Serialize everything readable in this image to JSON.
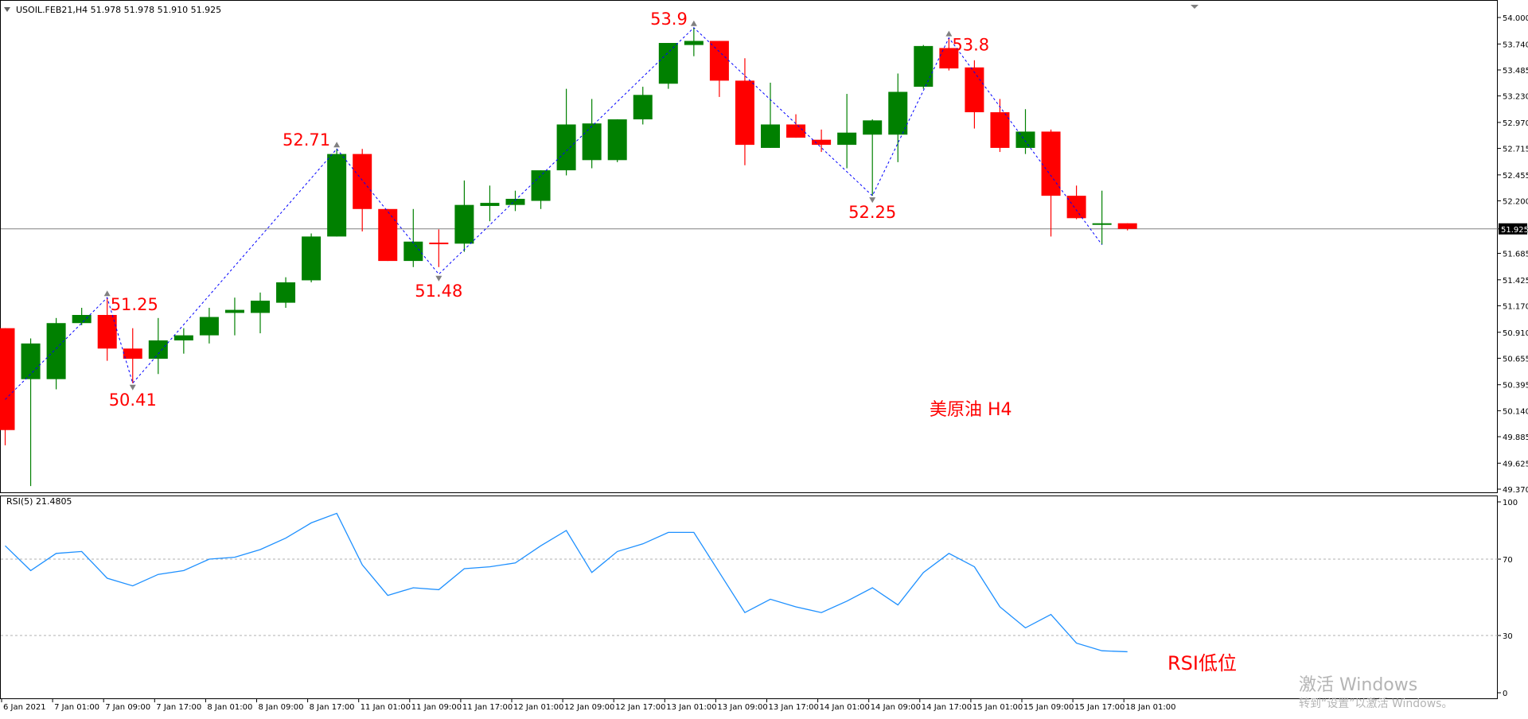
{
  "header": {
    "symbol_text": "USOIL.FEB21,H4  51.978 51.978 51.910 51.925",
    "triangle_icon": "triangle-down-icon"
  },
  "rsi_label": "RSI(5) 21.4805",
  "annotation": {
    "title": "美原油 H4",
    "rsi_note": "RSI低位"
  },
  "watermark": {
    "line1": "激活 Windows",
    "line2": "转到“设置”以激活 Windows。"
  },
  "colors": {
    "bull": "#008000",
    "bear": "#ff0000",
    "zigzag": "#0000ff",
    "rsi": "#1e90ff",
    "label": "#ff0000",
    "current_line": "#808080"
  },
  "chart_data": [
    {
      "type": "candlestick",
      "symbol": "USOIL.FEB21",
      "timeframe": "H4",
      "y_ticks": [
        54.0,
        53.74,
        53.485,
        53.23,
        52.97,
        52.715,
        52.455,
        52.2,
        51.925,
        51.685,
        51.425,
        51.17,
        50.91,
        50.655,
        50.395,
        50.14,
        49.885,
        49.625,
        49.37
      ],
      "y_tick_labels": [
        "54.000",
        "53.740",
        "53.485",
        "53.230",
        "52.970",
        "52.715",
        "52.455",
        "52.200",
        "51.925",
        "51.685",
        "51.425",
        "51.170",
        "50.910",
        "50.655",
        "50.395",
        "50.140",
        "49.885",
        "49.625",
        "49.370"
      ],
      "ylim": [
        49.37,
        54.0
      ],
      "current_price": 51.925,
      "current_price_label": "51.925",
      "x_labels": [
        "6 Jan 2021",
        "7 Jan 01:00",
        "7 Jan 09:00",
        "7 Jan 17:00",
        "8 Jan 01:00",
        "8 Jan 09:00",
        "8 Jan 17:00",
        "11 Jan 01:00",
        "11 Jan 09:00",
        "11 Jan 17:00",
        "12 Jan 01:00",
        "12 Jan 09:00",
        "12 Jan 17:00",
        "13 Jan 01:00",
        "13 Jan 09:00",
        "13 Jan 17:00",
        "14 Jan 01:00",
        "14 Jan 09:00",
        "14 Jan 17:00",
        "15 Jan 01:00",
        "15 Jan 09:00",
        "15 Jan 17:00",
        "18 Jan 01:00"
      ],
      "candles": [
        {
          "o": 50.95,
          "h": 50.95,
          "l": 49.8,
          "c": 49.95
        },
        {
          "o": 50.45,
          "h": 50.85,
          "l": 49.4,
          "c": 50.8
        },
        {
          "o": 50.45,
          "h": 51.05,
          "l": 50.35,
          "c": 51.0
        },
        {
          "o": 51.0,
          "h": 51.15,
          "l": 50.98,
          "c": 51.08
        },
        {
          "o": 51.08,
          "h": 51.25,
          "l": 50.63,
          "c": 50.75
        },
        {
          "o": 50.75,
          "h": 50.95,
          "l": 50.41,
          "c": 50.65
        },
        {
          "o": 50.65,
          "h": 51.05,
          "l": 50.5,
          "c": 50.83
        },
        {
          "o": 50.83,
          "h": 50.95,
          "l": 50.7,
          "c": 50.88
        },
        {
          "o": 50.88,
          "h": 51.15,
          "l": 50.8,
          "c": 51.06
        },
        {
          "o": 51.1,
          "h": 51.25,
          "l": 50.88,
          "c": 51.13
        },
        {
          "o": 51.1,
          "h": 51.3,
          "l": 50.9,
          "c": 51.22
        },
        {
          "o": 51.2,
          "h": 51.45,
          "l": 51.15,
          "c": 51.4
        },
        {
          "o": 51.42,
          "h": 51.88,
          "l": 51.4,
          "c": 51.85
        },
        {
          "o": 51.85,
          "h": 52.71,
          "l": 51.85,
          "c": 52.66
        },
        {
          "o": 52.66,
          "h": 52.71,
          "l": 51.9,
          "c": 52.12
        },
        {
          "o": 52.12,
          "h": 52.12,
          "l": 51.61,
          "c": 51.61
        },
        {
          "o": 51.61,
          "h": 52.12,
          "l": 51.55,
          "c": 51.8
        },
        {
          "o": 51.79,
          "h": 51.92,
          "l": 51.55,
          "c": 51.78
        },
        {
          "o": 51.78,
          "h": 52.4,
          "l": 51.7,
          "c": 52.16
        },
        {
          "o": 52.15,
          "h": 52.35,
          "l": 52.0,
          "c": 52.18
        },
        {
          "o": 52.16,
          "h": 52.3,
          "l": 52.1,
          "c": 52.22
        },
        {
          "o": 52.2,
          "h": 52.5,
          "l": 52.12,
          "c": 52.5
        },
        {
          "o": 52.5,
          "h": 53.3,
          "l": 52.45,
          "c": 52.95
        },
        {
          "o": 52.6,
          "h": 53.2,
          "l": 52.52,
          "c": 52.96
        },
        {
          "o": 52.6,
          "h": 53.0,
          "l": 52.58,
          "c": 53.0
        },
        {
          "o": 53.0,
          "h": 53.32,
          "l": 52.95,
          "c": 53.24
        },
        {
          "o": 53.35,
          "h": 53.75,
          "l": 53.3,
          "c": 53.75
        },
        {
          "o": 53.73,
          "h": 53.9,
          "l": 53.62,
          "c": 53.77
        },
        {
          "o": 53.77,
          "h": 53.77,
          "l": 53.22,
          "c": 53.38
        },
        {
          "o": 53.38,
          "h": 53.6,
          "l": 52.55,
          "c": 52.75
        },
        {
          "o": 52.72,
          "h": 53.36,
          "l": 52.72,
          "c": 52.95
        },
        {
          "o": 52.95,
          "h": 53.05,
          "l": 52.82,
          "c": 52.82
        },
        {
          "o": 52.8,
          "h": 52.9,
          "l": 52.68,
          "c": 52.75
        },
        {
          "o": 52.75,
          "h": 53.25,
          "l": 52.52,
          "c": 52.87
        },
        {
          "o": 52.85,
          "h": 53.0,
          "l": 52.25,
          "c": 52.99
        },
        {
          "o": 52.85,
          "h": 53.45,
          "l": 52.58,
          "c": 53.27
        },
        {
          "o": 53.32,
          "h": 53.73,
          "l": 53.3,
          "c": 53.72
        },
        {
          "o": 53.7,
          "h": 53.8,
          "l": 53.48,
          "c": 53.5
        },
        {
          "o": 53.51,
          "h": 53.58,
          "l": 52.91,
          "c": 53.07
        },
        {
          "o": 53.07,
          "h": 53.2,
          "l": 52.68,
          "c": 52.72
        },
        {
          "o": 52.72,
          "h": 53.1,
          "l": 52.66,
          "c": 52.88
        },
        {
          "o": 52.88,
          "h": 52.9,
          "l": 51.85,
          "c": 52.25
        },
        {
          "o": 52.25,
          "h": 52.35,
          "l": 52.02,
          "c": 52.03
        },
        {
          "o": 51.97,
          "h": 52.3,
          "l": 51.77,
          "c": 51.98
        },
        {
          "o": 51.98,
          "h": 51.98,
          "l": 51.91,
          "c": 51.925
        }
      ],
      "zigzag": [
        {
          "i": 0,
          "v": 50.25
        },
        {
          "i": 4,
          "v": 51.25
        },
        {
          "i": 5,
          "v": 50.41
        },
        {
          "i": 13,
          "v": 52.71
        },
        {
          "i": 17,
          "v": 51.48
        },
        {
          "i": 27,
          "v": 53.9
        },
        {
          "i": 34,
          "v": 52.25
        },
        {
          "i": 37,
          "v": 53.8
        },
        {
          "i": 43,
          "v": 51.77
        }
      ],
      "pivot_labels": [
        {
          "text": "51.25",
          "i": 4,
          "v": 51.25,
          "pos": "above-right"
        },
        {
          "text": "50.41",
          "i": 5,
          "v": 50.41,
          "pos": "below"
        },
        {
          "text": "52.71",
          "i": 13,
          "v": 52.71,
          "pos": "above-left"
        },
        {
          "text": "51.48",
          "i": 17,
          "v": 51.48,
          "pos": "below"
        },
        {
          "text": "53.9",
          "i": 27,
          "v": 53.9,
          "pos": "above-left"
        },
        {
          "text": "52.25",
          "i": 34,
          "v": 52.25,
          "pos": "below"
        },
        {
          "text": "53.8",
          "i": 37,
          "v": 53.8,
          "pos": "above-right"
        }
      ]
    },
    {
      "type": "line",
      "name": "RSI(5)",
      "ylim": [
        0,
        100
      ],
      "y_ticks": [
        100,
        70,
        30,
        0
      ],
      "y_tick_labels": [
        "100",
        "70",
        "30",
        "0"
      ],
      "levels": [
        70,
        30
      ],
      "values": [
        77,
        64,
        73,
        74,
        60,
        56,
        62,
        64,
        70,
        71,
        75,
        81,
        89,
        94,
        67,
        51,
        55,
        54,
        65,
        66,
        68,
        77,
        85,
        63,
        74,
        78,
        84,
        84,
        63,
        42,
        49,
        45,
        42,
        48,
        55,
        46,
        63,
        73,
        66,
        45,
        34,
        41,
        26,
        22,
        21.4805
      ]
    }
  ]
}
